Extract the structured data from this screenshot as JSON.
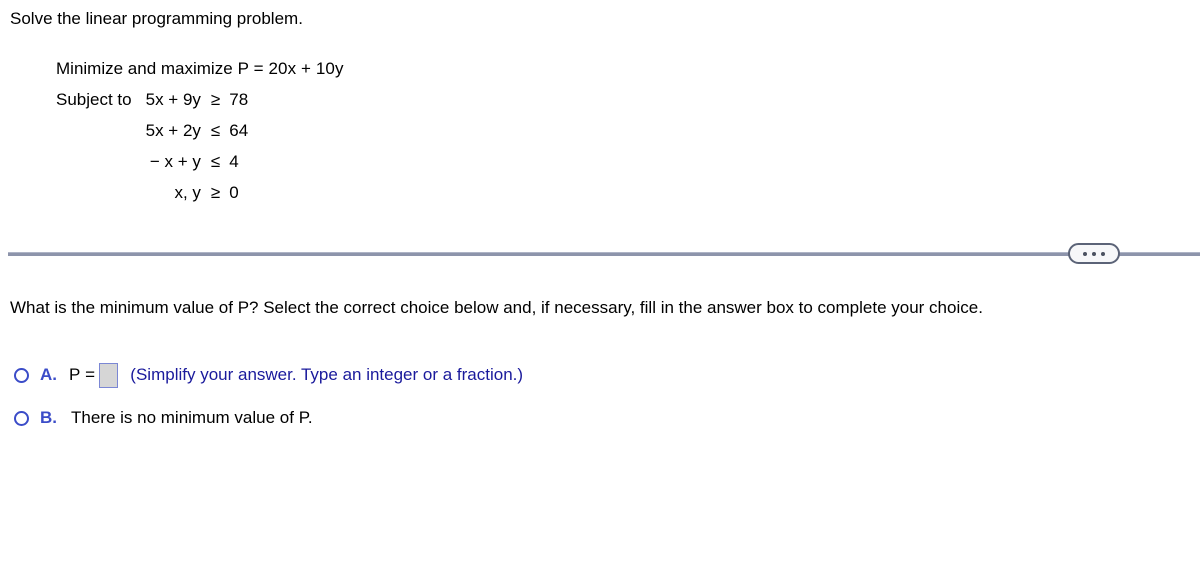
{
  "problem": {
    "title": "Solve the linear programming problem.",
    "objective": {
      "label": "Minimize and maximize",
      "expression": "P = 20x + 10y"
    },
    "subject_to_label": "Subject to",
    "constraints": [
      {
        "lhs": "5x + 9y",
        "relation": "≥",
        "rhs": "78"
      },
      {
        "lhs": "5x + 2y",
        "relation": "≤",
        "rhs": "64"
      },
      {
        "lhs": "− x + y",
        "relation": "≤",
        "rhs": "4"
      },
      {
        "lhs": "x, y",
        "relation": "≥",
        "rhs": "0"
      }
    ]
  },
  "divider": {
    "more_button_label": "• • •",
    "line_color": "#8d94ab"
  },
  "question": {
    "text": "What is the minimum value of P? Select the correct choice below and, if necessary, fill in the answer box to complete your choice."
  },
  "choices": [
    {
      "letter": "A.",
      "prefix": "P =",
      "answer_value": "",
      "answer_placeholder": "",
      "hint": "(Simplify your answer. Type an integer or a fraction.)"
    },
    {
      "letter": "B.",
      "statement": "There is no minimum value of P."
    }
  ],
  "colors": {
    "choice_letter_blue": "#3b4cc8",
    "hint_navy": "#1a1a9c",
    "answer_box_fill": "#d6d6d6",
    "answer_box_border": "#7b87d4",
    "divider": "#8d94ab"
  }
}
